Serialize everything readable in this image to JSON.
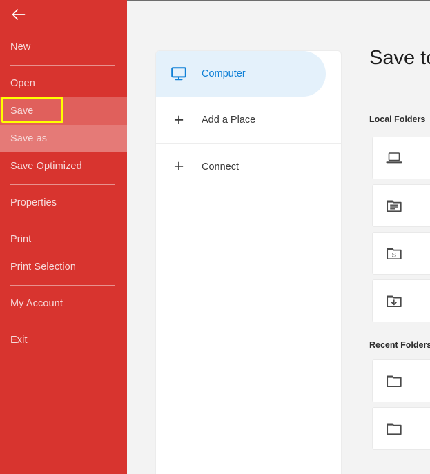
{
  "window": {
    "accent_red": "#d8342f",
    "accent_red_hover": "#e0605c",
    "accent_red_active": "#e57a77",
    "accent_blue": "#0f80d6",
    "highlight_color": "#ffff00",
    "page_background": "#f3f3f3"
  },
  "sidebar": {
    "back_button": {
      "name": "back-arrow-icon",
      "label": "Back"
    },
    "items": [
      {
        "label": "New",
        "state": "normal",
        "divider_after": true
      },
      {
        "label": "Open",
        "state": "normal",
        "divider_after": false
      },
      {
        "label": "Save",
        "state": "hovered",
        "divider_after": false,
        "highlighted": true
      },
      {
        "label": "Save as",
        "state": "active",
        "divider_after": false
      },
      {
        "label": "Save Optimized",
        "state": "normal",
        "divider_after": true
      },
      {
        "label": "Properties",
        "state": "normal",
        "divider_after": true
      },
      {
        "label": "Print",
        "state": "normal",
        "divider_after": false
      },
      {
        "label": "Print Selection",
        "state": "normal",
        "divider_after": true
      },
      {
        "label": "My Account",
        "state": "normal",
        "divider_after": true
      },
      {
        "label": "Exit",
        "state": "normal",
        "divider_after": false
      }
    ]
  },
  "places": {
    "rows": [
      {
        "label": "Computer",
        "icon": "monitor-icon",
        "selected": true
      },
      {
        "label": "Add a Place",
        "icon": "plus-icon",
        "selected": false
      },
      {
        "label": "Connect",
        "icon": "plus-icon",
        "selected": false
      }
    ]
  },
  "save_pane": {
    "title": "Save to",
    "local_heading": "Local Folders",
    "recent_heading": "Recent Folders",
    "local_folders": [
      {
        "icon": "laptop-icon",
        "label": ""
      },
      {
        "icon": "documents-folder-icon",
        "label": ""
      },
      {
        "icon": "folder-s-icon",
        "label": ""
      },
      {
        "icon": "downloads-folder-icon",
        "label": ""
      }
    ],
    "recent_folders": [
      {
        "icon": "folder-icon",
        "label": ""
      },
      {
        "icon": "folder-icon",
        "label": ""
      }
    ]
  }
}
